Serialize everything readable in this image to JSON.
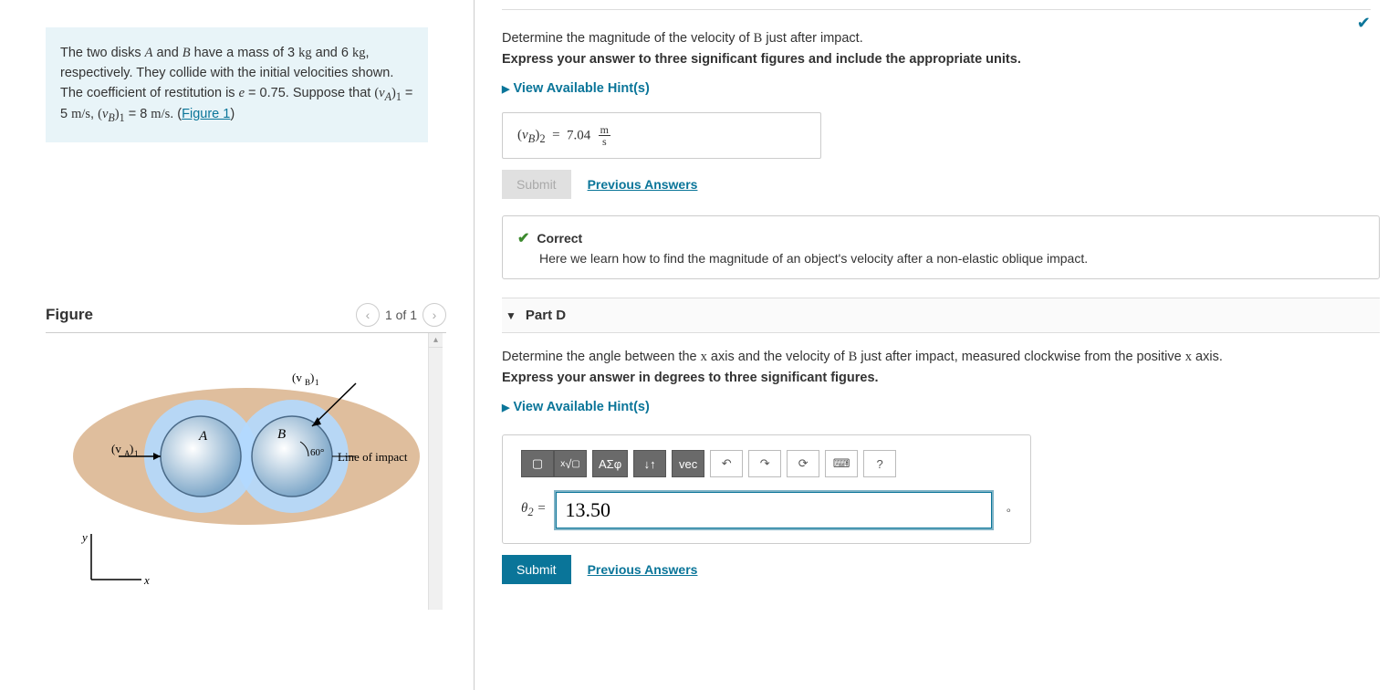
{
  "problem": {
    "text_prefix": "The two disks ",
    "A": "A",
    "and": " and ",
    "B": "B",
    "text1": " have a mass of 3 ",
    "kg": "kg",
    "text2": " and 6 ",
    "text3": ", respectively. They collide with the initial velocities shown. The coefficient of restitution is ",
    "e": "e",
    "evalue": " = 0.75. Suppose that ",
    "va": "(v_A)_1",
    "va_expr": " = 5 ",
    "ms": "m/s",
    "comma": ", ",
    "vb": "(v_B)_1",
    "vb_expr": " = 8 ",
    "period": ". (",
    "figlink": "Figure 1",
    "close": ")"
  },
  "figure": {
    "title": "Figure",
    "pager": "1 of 1",
    "labels": {
      "vA1": "(v_A)_1",
      "vB1": "(v_B)_1",
      "A": "A",
      "B": "B",
      "angle": "60°",
      "line": "Line of impact",
      "x": "x",
      "y": "y"
    }
  },
  "partC": {
    "prompt": "Determine the magnitude of the velocity of ",
    "B": "B",
    "prompt2": " just after impact.",
    "instruct": "Express your answer to three significant figures and include the appropriate units.",
    "hints": "View Available Hint(s)",
    "answer_label": "(v_B)_2 = ",
    "answer_value": "7.04",
    "answer_unit_num": "m",
    "answer_unit_den": "s",
    "submit": "Submit",
    "prev": "Previous Answers",
    "correct": "Correct",
    "feedback": "Here we learn how to find the magnitude of an object's velocity after a non-elastic oblique impact."
  },
  "partD": {
    "title": "Part D",
    "prompt1": "Determine the angle between the ",
    "x": "x",
    "prompt2": " axis and the velocity of ",
    "B": "B",
    "prompt3": " just after impact, measured clockwise from the positive ",
    "prompt4": " axis.",
    "instruct": "Express your answer in degrees to three significant figures.",
    "hints": "View Available Hint(s)",
    "theta_label": "θ_2 = ",
    "input_value": "13.50",
    "unit": "°",
    "submit": "Submit",
    "prev": "Previous Answers",
    "tools": {
      "template": "▢",
      "sqrt": "√",
      "greek": "ΑΣφ",
      "updown": "↓↑",
      "vec": "vec",
      "undo": "↶",
      "redo": "↷",
      "reset": "⟳",
      "keyboard": "⌨",
      "help": "?"
    }
  }
}
